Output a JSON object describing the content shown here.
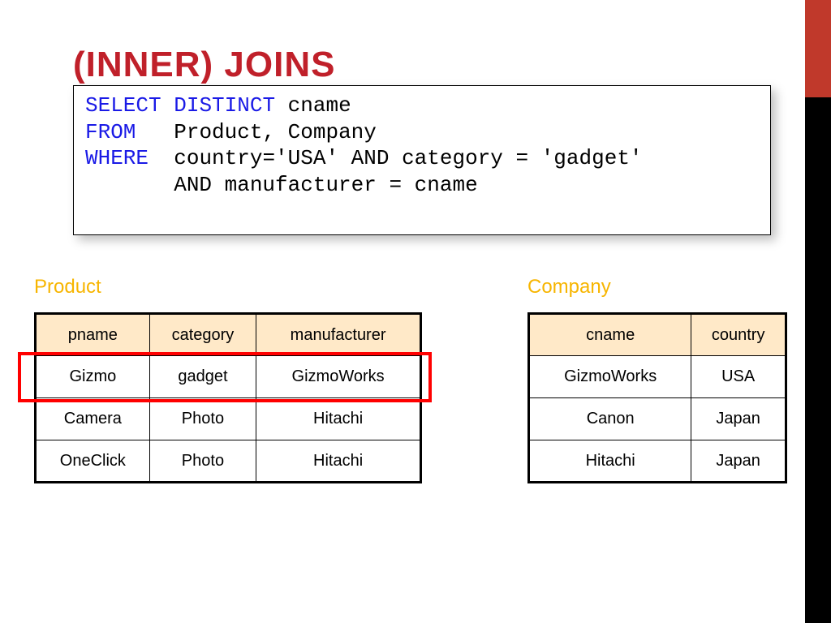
{
  "title": "(INNER) JOINS",
  "sql": {
    "select": "SELECT",
    "distinct": "DISTINCT",
    "select_cols": " cname",
    "from": "FROM",
    "from_pad": "   ",
    "from_tables": "Product, Company",
    "where": "WHERE",
    "where_pad": "  ",
    "where_cond1": "country='USA' AND category = 'gadget'",
    "where_pad2": "       ",
    "where_cond2": "AND manufacturer = cname"
  },
  "labels": {
    "product": "Product",
    "company": "Company"
  },
  "product": {
    "headers": [
      "pname",
      "category",
      "manufacturer"
    ],
    "rows": [
      [
        "Gizmo",
        "gadget",
        "GizmoWorks"
      ],
      [
        "Camera",
        "Photo",
        "Hitachi"
      ],
      [
        "OneClick",
        "Photo",
        "Hitachi"
      ]
    ]
  },
  "company": {
    "headers": [
      "cname",
      "country"
    ],
    "rows": [
      [
        "GizmoWorks",
        "USA"
      ],
      [
        "Canon",
        "Japan"
      ],
      [
        "Hitachi",
        "Japan"
      ]
    ]
  }
}
